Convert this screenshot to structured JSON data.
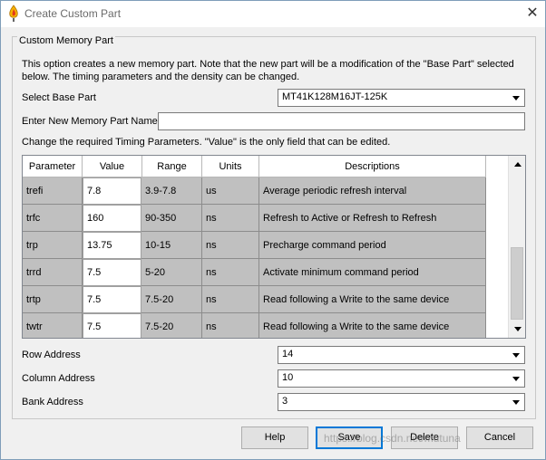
{
  "window": {
    "title": "Create Custom Part"
  },
  "group": {
    "legend": "Custom Memory Part",
    "intro": "This option creates a new memory part. Note that the new part will be a modification of the \"Base Part\" selected below. The timing parameters and the density can be changed."
  },
  "base_part": {
    "label": "Select Base Part",
    "value": "MT41K128M16JT-125K"
  },
  "new_name": {
    "label": "Enter New Memory Part Name",
    "value": ""
  },
  "timing_note": "Change the required Timing Parameters. \"Value\" is the only field that can be edited.",
  "table": {
    "columns": [
      "Parameter",
      "Value",
      "Range",
      "Units",
      "Descriptions"
    ],
    "rows": [
      {
        "param": "trefi",
        "value": "7.8",
        "range": "3.9-7.8",
        "units": "us",
        "desc": "Average periodic refresh interval"
      },
      {
        "param": "trfc",
        "value": "160",
        "range": "90-350",
        "units": "ns",
        "desc": "Refresh to Active or Refresh to Refresh"
      },
      {
        "param": "trp",
        "value": "13.75",
        "range": "10-15",
        "units": "ns",
        "desc": "Precharge command period"
      },
      {
        "param": "trrd",
        "value": "7.5",
        "range": "5-20",
        "units": "ns",
        "desc": "Activate minimum command period"
      },
      {
        "param": "trtp",
        "value": "7.5",
        "range": "7.5-20",
        "units": "ns",
        "desc": "Read following a Write to the same device"
      },
      {
        "param": "twtr",
        "value": "7.5",
        "range": "7.5-20",
        "units": "ns",
        "desc": "Read following a Write to the same device"
      }
    ]
  },
  "row_address": {
    "label": "Row Address",
    "value": "14"
  },
  "column_address": {
    "label": "Column Address",
    "value": "10"
  },
  "bank_address": {
    "label": "Bank Address",
    "value": "3"
  },
  "buttons": {
    "help": "Help",
    "save": "Save",
    "delete": "Delete",
    "cancel": "Cancel"
  },
  "watermark": "https://blog.csdn.net/mutuna"
}
